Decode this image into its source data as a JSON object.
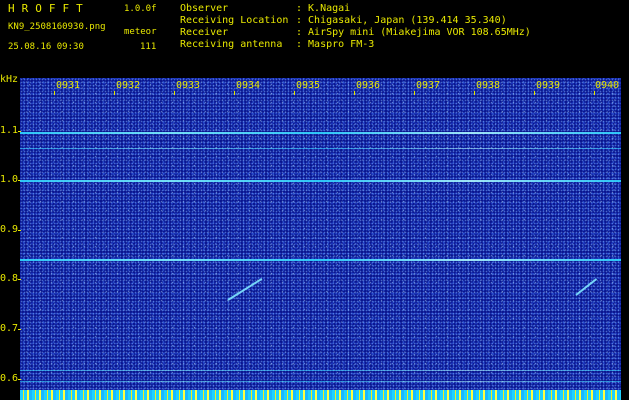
{
  "header": {
    "brand": "HROFFT",
    "version": "1.0.0f",
    "filename": "KN9_2508160930.png",
    "meteor_label": "meteor",
    "datetime": "25.08.16 09:30",
    "count": "111",
    "info": [
      {
        "key": "Observer",
        "value": ": K.Nagai"
      },
      {
        "key": "Receiving Location",
        "value": ": Chigasaki, Japan (139.414 35.340)"
      },
      {
        "key": "Receiver",
        "value": ": AirSpy mini (Miakejima VOR 108.65MHz)"
      },
      {
        "key": "Receiving antenna",
        "value": ": Maspro FM-3"
      }
    ]
  },
  "axis": {
    "y_unit": "kHz",
    "y_ticks": [
      "1.1",
      "1.0",
      "0.9",
      "0.8",
      "0.7",
      "0.6"
    ],
    "x_ticks": [
      "0931",
      "0932",
      "0933",
      "0934",
      "0935",
      "0936",
      "0937",
      "0938",
      "0939",
      "0940"
    ]
  },
  "colors": {
    "text": "#e8e800",
    "background": "#0a1690",
    "signal": "#7ff2ff"
  }
}
